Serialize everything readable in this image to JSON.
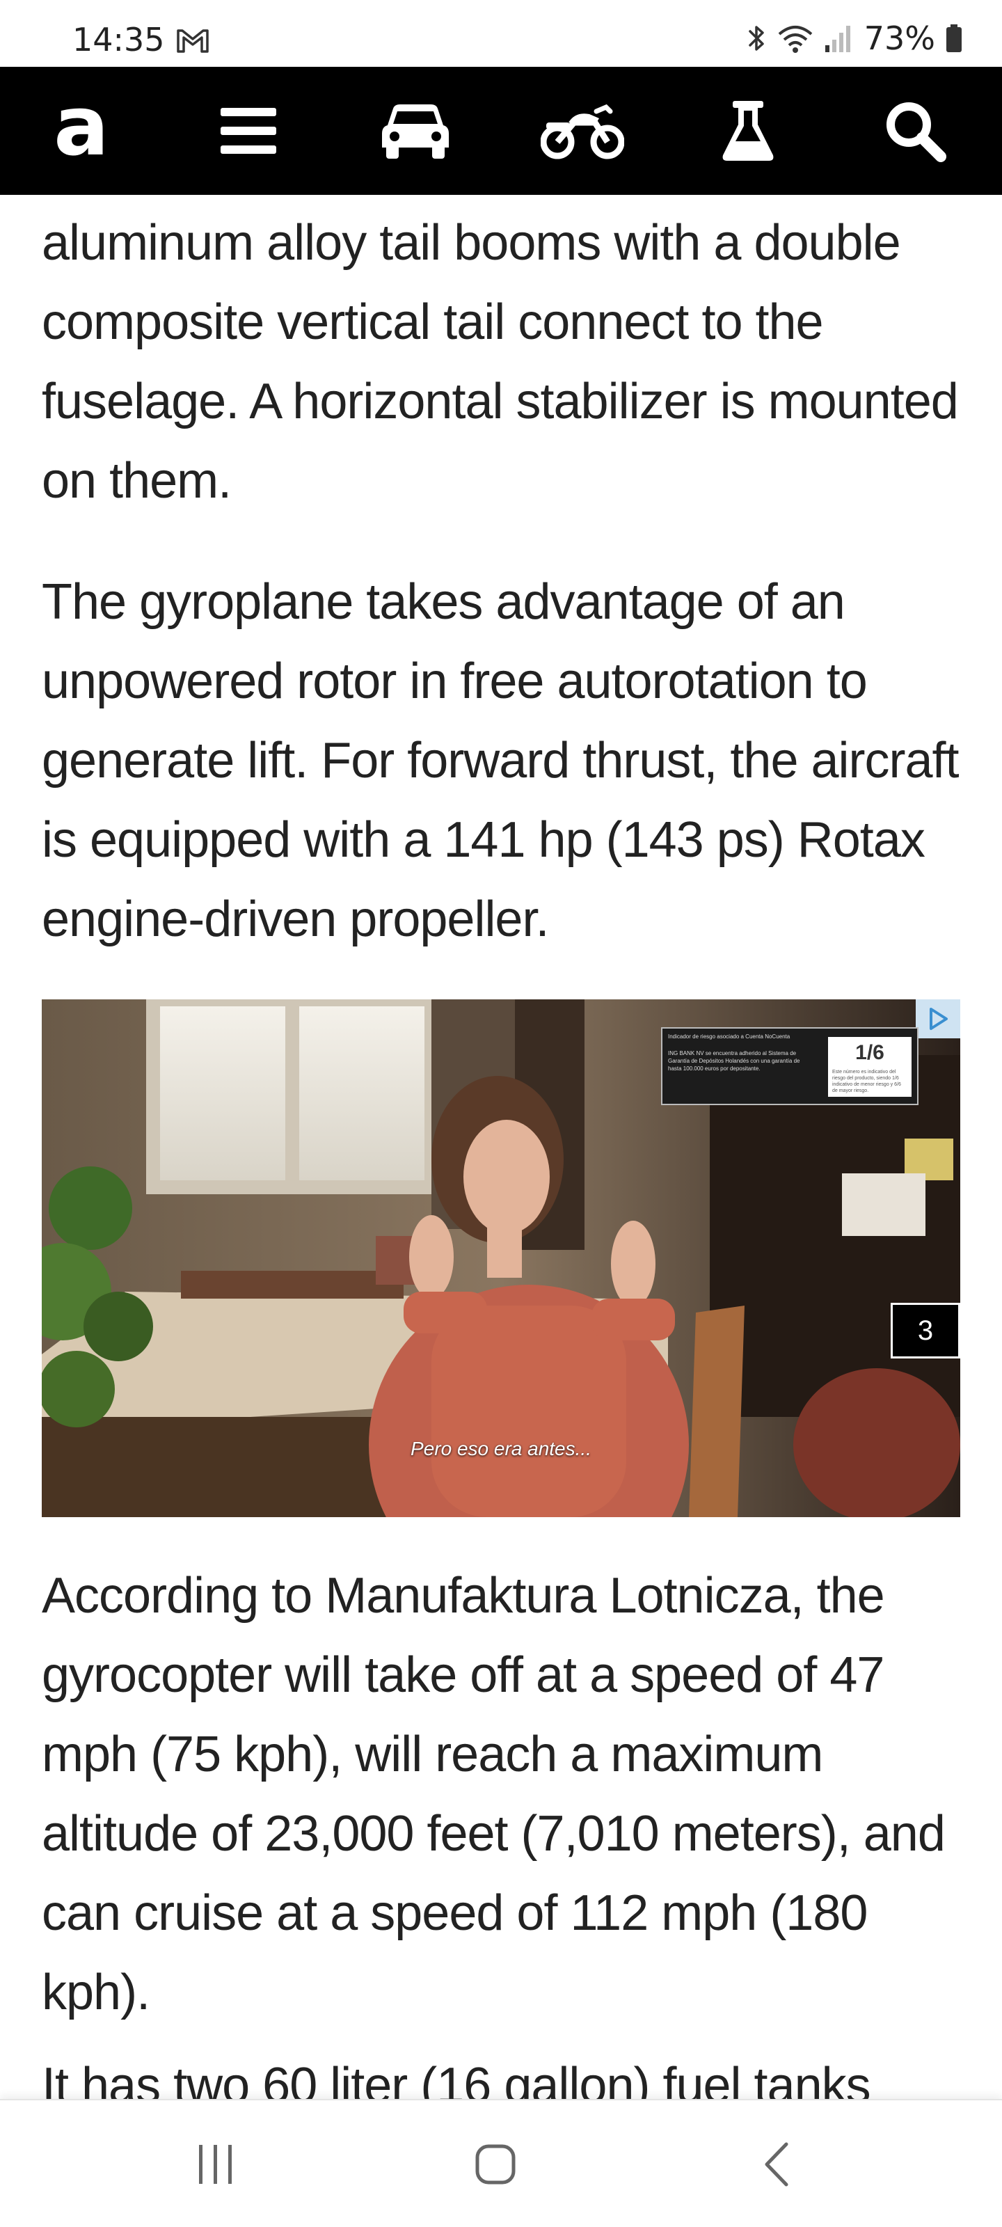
{
  "status_bar": {
    "time": "14:35",
    "battery": "73%",
    "icons": [
      "gmail-icon",
      "bluetooth-icon",
      "wifi-icon",
      "signal-icon",
      "battery-icon"
    ]
  },
  "nav": {
    "logo": "a",
    "items": [
      "menu-icon",
      "car-icon",
      "motorcycle-icon",
      "flask-icon",
      "search-icon"
    ]
  },
  "article": {
    "paragraph_1": "aluminum alloy tail booms with a double composite vertical tail connect to the fuselage. A horizontal stabilizer is mounted on them.",
    "paragraph_2": "The gyroplane takes advantage of an unpowered rotor in free autorotation to generate lift. For forward thrust, the aircraft is equipped with a 141 hp (143 ps) Rotax engine-driven propeller.",
    "paragraph_3": "According to Manufaktura Lotnicza, the gyrocopter will take off at a speed of 47 mph (75 kph), will reach a maximum altitude of 23,000 feet (7,010 meters), and can cruise at a speed of 112 mph (180 kph).",
    "paragraph_4_partial": "It has two 60 liter (16 gallon) fuel tanks"
  },
  "video_ad": {
    "subtitle": "Pero eso era antes...",
    "counter": "3",
    "info_number": "1/6",
    "info_text": "Indicador de riesgo asociado a Cuenta NoCuenta",
    "info_body": "ING BANK NV se encuentra adherido al Sistema de Garantía de Depósitos Holandés con una garantía de hasta 100.000 euros por depositante.",
    "info_small": "Este número es indicativo del riesgo del producto, siendo 1/6 indicativo de menor riesgo y 6/6 de mayor riesgo."
  },
  "bottom_nav": {
    "items": [
      "recent-apps-icon",
      "home-icon",
      "back-icon"
    ]
  },
  "colors": {
    "nav_bg": "#000000",
    "text": "#222222",
    "background": "#ffffff"
  }
}
